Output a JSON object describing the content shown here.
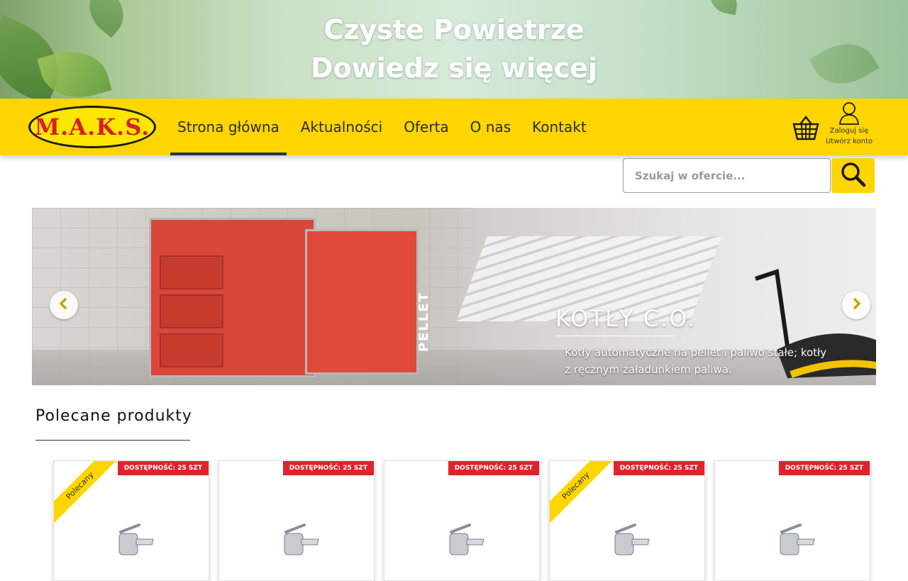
{
  "promo": {
    "line1": "Czyste Powietrze",
    "line2": "Dowiedz się więcej"
  },
  "header": {
    "logo_text": "M.A.K.S.",
    "nav": [
      "Strona główna",
      "Aktualności",
      "Oferta",
      "O nas",
      "Kontakt"
    ],
    "active_nav": "Strona główna",
    "account": {
      "login": "Zaloguj się",
      "register": "Utwórz konto"
    }
  },
  "search": {
    "placeholder": "Szukaj w ofercie..."
  },
  "slider": {
    "title": "KOTŁY C.O.",
    "text": "Kotły automatyczne na pellet i paliwo stałe; kotły z ręcznym załadunkiem paliwa.",
    "product_label": "PELLET"
  },
  "products_section": {
    "title": "Polecane produkty",
    "items": [
      {
        "availability": "DOSTĘPNOŚĆ: 25 SZT",
        "ribbon": "Polecany"
      },
      {
        "availability": "DOSTĘPNOŚĆ: 25 SZT",
        "ribbon": ""
      },
      {
        "availability": "DOSTĘPNOŚĆ: 25 SZT",
        "ribbon": ""
      },
      {
        "availability": "DOSTĘPNOŚĆ: 25 SZT",
        "ribbon": "Polecany"
      },
      {
        "availability": "DOSTĘPNOŚĆ: 25 SZT",
        "ribbon": ""
      }
    ]
  },
  "colors": {
    "brand_yellow": "#ffd500",
    "badge_red": "#e0232a",
    "nav_underline": "#24364a"
  }
}
